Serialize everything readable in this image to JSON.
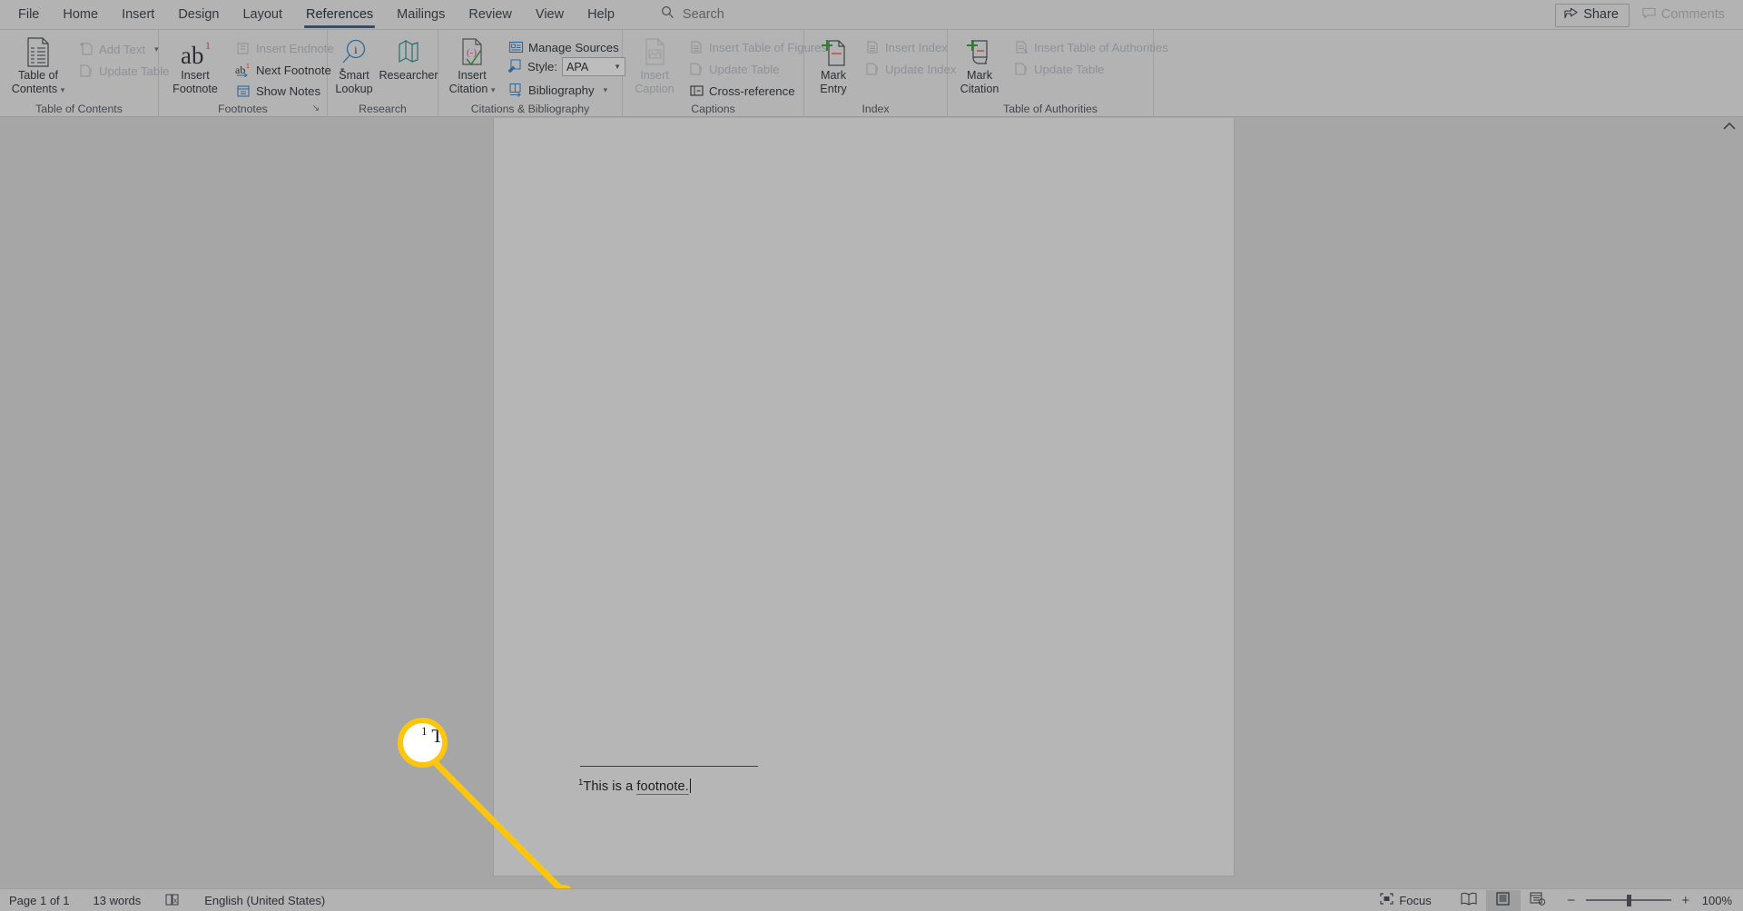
{
  "window": {
    "app": "Microsoft Word",
    "background_color": "#a6a6a6",
    "ribbon_color": "#b3b3b3",
    "accent_color": "#fcc60f"
  },
  "tabs": [
    {
      "label": "File",
      "active": false
    },
    {
      "label": "Home",
      "active": false
    },
    {
      "label": "Insert",
      "active": false
    },
    {
      "label": "Design",
      "active": false
    },
    {
      "label": "Layout",
      "active": false
    },
    {
      "label": "References",
      "active": true
    },
    {
      "label": "Mailings",
      "active": false
    },
    {
      "label": "Review",
      "active": false
    },
    {
      "label": "View",
      "active": false
    },
    {
      "label": "Help",
      "active": false
    }
  ],
  "search": {
    "label": "Search",
    "icon": "search-icon"
  },
  "titlebar_right": {
    "share": {
      "label": "Share",
      "icon": "share-icon"
    },
    "comments": {
      "label": "Comments",
      "icon": "comment-icon",
      "disabled": true
    }
  },
  "ribbon": {
    "groups": [
      {
        "name": "table-of-contents",
        "label": "Table of Contents",
        "big_buttons": [
          {
            "label_line1": "Table of",
            "label_line2": "Contents",
            "icon": "table-of-contents-icon",
            "has_dropdown": true
          }
        ],
        "small_buttons": [
          {
            "label": "Add Text",
            "icon": "add-text-icon",
            "disabled": true,
            "has_dropdown": true
          },
          {
            "label": "Update Table",
            "icon": "update-table-icon",
            "disabled": true,
            "has_dropdown": false
          }
        ]
      },
      {
        "name": "footnotes",
        "label": "Footnotes",
        "dialog_launcher": true,
        "big_buttons": [
          {
            "label_line1": "Insert",
            "label_line2": "Footnote",
            "icon": "insert-footnote-icon",
            "has_dropdown": false
          }
        ],
        "small_buttons": [
          {
            "label": "Insert Endnote",
            "icon": "insert-endnote-icon",
            "disabled": true,
            "has_dropdown": false
          },
          {
            "label": "Next Footnote",
            "icon": "next-footnote-icon",
            "disabled": false,
            "has_dropdown": true
          },
          {
            "label": "Show Notes",
            "icon": "show-notes-icon",
            "disabled": false,
            "has_dropdown": false
          }
        ]
      },
      {
        "name": "research",
        "label": "Research",
        "big_buttons": [
          {
            "label_line1": "Smart",
            "label_line2": "Lookup",
            "icon": "smart-lookup-icon",
            "has_dropdown": false
          },
          {
            "label_line1": "Researcher",
            "label_line2": "",
            "icon": "researcher-icon",
            "has_dropdown": false
          }
        ],
        "small_buttons": []
      },
      {
        "name": "citations-and-bibliography",
        "label": "Citations & Bibliography",
        "big_buttons": [
          {
            "label_line1": "Insert",
            "label_line2": "Citation",
            "icon": "insert-citation-icon",
            "has_dropdown": true
          }
        ],
        "small_buttons": [
          {
            "label": "Manage Sources",
            "icon": "manage-sources-icon",
            "disabled": false,
            "has_dropdown": false
          },
          {
            "label": "Bibliography",
            "icon": "bibliography-icon",
            "disabled": false,
            "has_dropdown": true
          }
        ],
        "style_row": {
          "label": "Style:",
          "icon": "style-icon",
          "value": "APA"
        }
      },
      {
        "name": "captions",
        "label": "Captions",
        "big_buttons": [
          {
            "label_line1": "Insert",
            "label_line2": "Caption",
            "icon": "insert-caption-icon",
            "has_dropdown": false,
            "disabled": true
          }
        ],
        "small_buttons": [
          {
            "label": "Insert Table of Figures",
            "icon": "insert-table-of-figures-icon",
            "disabled": true,
            "has_dropdown": false
          },
          {
            "label": "Update Table",
            "icon": "update-table-icon",
            "disabled": true,
            "has_dropdown": false
          },
          {
            "label": "Cross-reference",
            "icon": "cross-reference-icon",
            "disabled": false,
            "has_dropdown": false
          }
        ]
      },
      {
        "name": "index",
        "label": "Index",
        "big_buttons": [
          {
            "label_line1": "Mark",
            "label_line2": "Entry",
            "icon": "mark-entry-icon",
            "has_dropdown": false
          }
        ],
        "small_buttons": [
          {
            "label": "Insert Index",
            "icon": "insert-index-icon",
            "disabled": true,
            "has_dropdown": false
          },
          {
            "label": "Update Index",
            "icon": "update-index-icon",
            "disabled": true,
            "has_dropdown": false
          }
        ]
      },
      {
        "name": "table-of-authorities",
        "label": "Table of Authorities",
        "big_buttons": [
          {
            "label_line1": "Mark",
            "label_line2": "Citation",
            "icon": "mark-citation-icon",
            "has_dropdown": false
          }
        ],
        "small_buttons": [
          {
            "label": "Insert Table of Authorities",
            "icon": "insert-table-of-authorities-icon",
            "disabled": true,
            "has_dropdown": false
          },
          {
            "label": "Update Table",
            "icon": "update-table-icon",
            "disabled": true,
            "has_dropdown": false
          }
        ]
      }
    ]
  },
  "document": {
    "footnote": {
      "marker": "1",
      "text_before": "This is a ",
      "text_underlined": "footnote.",
      "full_text": "1 This is a footnote."
    }
  },
  "callout": {
    "magnified_marker": "1",
    "magnified_text": "Th",
    "highlight_color": "#fcc60f"
  },
  "statusbar": {
    "page": "Page 1 of 1",
    "words": "13 words",
    "proofing_icon": "proofing-errors-icon",
    "language": "English (United States)",
    "focus": {
      "label": "Focus",
      "icon": "focus-icon"
    },
    "views": [
      {
        "name": "read-mode",
        "icon": "read-mode-icon",
        "selected": false
      },
      {
        "name": "print-layout",
        "icon": "print-layout-icon",
        "selected": true
      },
      {
        "name": "web-layout",
        "icon": "web-layout-icon",
        "selected": false
      }
    ],
    "zoom_out": "−",
    "zoom_in": "+",
    "zoom_value": "100%"
  }
}
